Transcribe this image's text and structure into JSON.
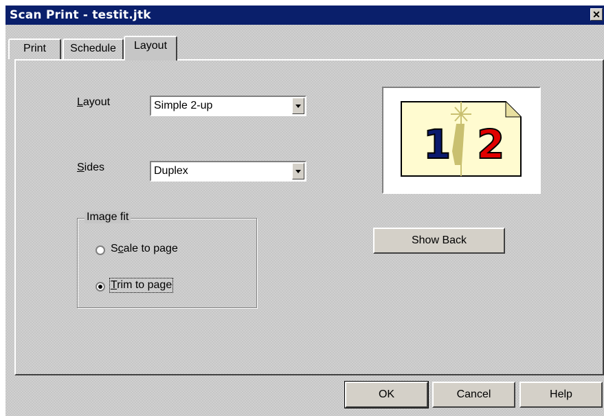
{
  "window": {
    "title": "Scan Print - testit.jtk",
    "close_symbol": "✕"
  },
  "tabs": [
    {
      "label": "Print",
      "active": false
    },
    {
      "label": "Schedule",
      "active": false
    },
    {
      "label": "Layout",
      "active": true
    }
  ],
  "layout": {
    "label_first": "L",
    "label_rest": "ayout",
    "value": "Simple 2-up"
  },
  "sides": {
    "label_first": "S",
    "label_rest": "ides",
    "value": "Duplex"
  },
  "image_fit": {
    "legend": "Image fit",
    "options": [
      {
        "pre": "S",
        "accel": "c",
        "post": "ale to page",
        "checked": false
      },
      {
        "pre": "",
        "accel": "T",
        "post": "rim to page",
        "checked": true
      }
    ]
  },
  "preview": {
    "page_left_number": "1",
    "page_right_number": "2",
    "colors": {
      "left_number": "#0a1a6e",
      "right_number": "#e00000",
      "page": "#fffbd0"
    }
  },
  "show_back_button": "Show Back",
  "footer_buttons": {
    "ok": "OK",
    "cancel": "Cancel",
    "help": "Help"
  }
}
